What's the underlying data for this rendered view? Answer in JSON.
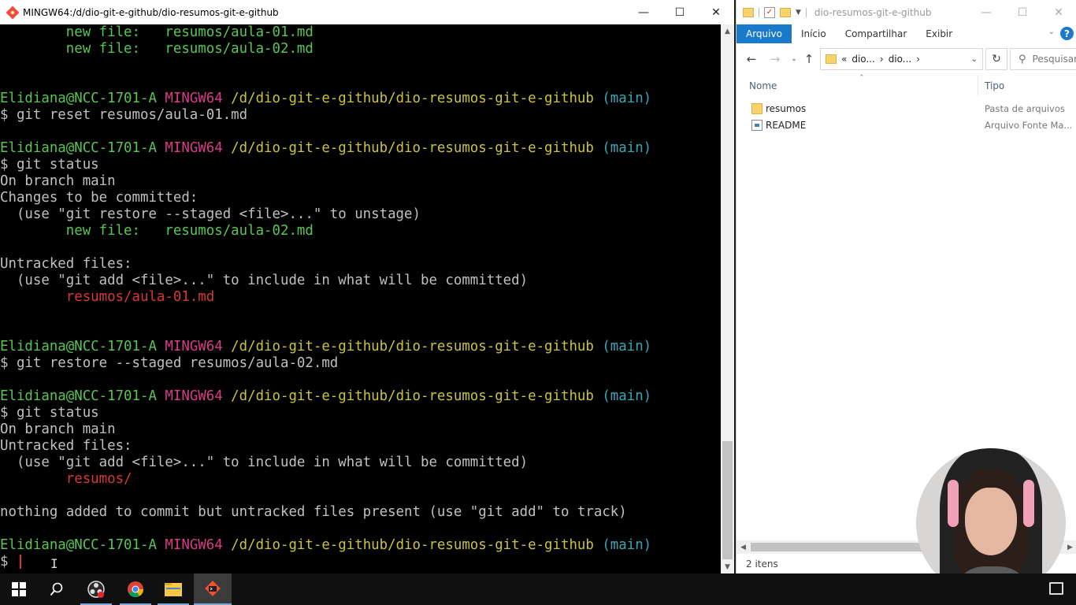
{
  "terminal": {
    "title": "MINGW64:/d/dio-git-e-github/dio-resumos-git-e-github",
    "lines": [
      [
        {
          "t": "        new file:   resumos/aula-01.md",
          "c": "green"
        }
      ],
      [
        {
          "t": "        new file:   resumos/aula-02.md",
          "c": "green"
        }
      ],
      [],
      [],
      [
        {
          "t": "Elidiana@NCC-1701-A ",
          "c": "green"
        },
        {
          "t": "MINGW64 ",
          "c": "magenta"
        },
        {
          "t": "/d/dio-git-e-github/dio-resumos-git-e-github ",
          "c": "yellow"
        },
        {
          "t": "(main)",
          "c": "cyan"
        }
      ],
      [
        {
          "t": "$ git reset resumos/aula-01.md",
          "c": ""
        }
      ],
      [],
      [
        {
          "t": "Elidiana@NCC-1701-A ",
          "c": "green"
        },
        {
          "t": "MINGW64 ",
          "c": "magenta"
        },
        {
          "t": "/d/dio-git-e-github/dio-resumos-git-e-github ",
          "c": "yellow"
        },
        {
          "t": "(main)",
          "c": "cyan"
        }
      ],
      [
        {
          "t": "$ git status",
          "c": ""
        }
      ],
      [
        {
          "t": "On branch main",
          "c": ""
        }
      ],
      [
        {
          "t": "Changes to be committed:",
          "c": ""
        }
      ],
      [
        {
          "t": "  (use \"git restore --staged <file>...\" to unstage)",
          "c": ""
        }
      ],
      [
        {
          "t": "        new file:   resumos/aula-02.md",
          "c": "green"
        }
      ],
      [],
      [
        {
          "t": "Untracked files:",
          "c": ""
        }
      ],
      [
        {
          "t": "  (use \"git add <file>...\" to include in what will be committed)",
          "c": ""
        }
      ],
      [
        {
          "t": "        resumos/aula-01.md",
          "c": "red"
        }
      ],
      [],
      [],
      [
        {
          "t": "Elidiana@NCC-1701-A ",
          "c": "green"
        },
        {
          "t": "MINGW64 ",
          "c": "magenta"
        },
        {
          "t": "/d/dio-git-e-github/dio-resumos-git-e-github ",
          "c": "yellow"
        },
        {
          "t": "(main)",
          "c": "cyan"
        }
      ],
      [
        {
          "t": "$ git restore --staged resumos/aula-02.md",
          "c": ""
        }
      ],
      [],
      [
        {
          "t": "Elidiana@NCC-1701-A ",
          "c": "green"
        },
        {
          "t": "MINGW64 ",
          "c": "magenta"
        },
        {
          "t": "/d/dio-git-e-github/dio-resumos-git-e-github ",
          "c": "yellow"
        },
        {
          "t": "(main)",
          "c": "cyan"
        }
      ],
      [
        {
          "t": "$ git status",
          "c": ""
        }
      ],
      [
        {
          "t": "On branch main",
          "c": ""
        }
      ],
      [
        {
          "t": "Untracked files:",
          "c": ""
        }
      ],
      [
        {
          "t": "  (use \"git add <file>...\" to include in what will be committed)",
          "c": ""
        }
      ],
      [
        {
          "t": "        resumos/",
          "c": "red"
        }
      ],
      [],
      [
        {
          "t": "nothing added to commit but untracked files present (use \"git add\" to track)",
          "c": ""
        }
      ],
      [],
      [
        {
          "t": "Elidiana@NCC-1701-A ",
          "c": "green"
        },
        {
          "t": "MINGW64 ",
          "c": "magenta"
        },
        {
          "t": "/d/dio-git-e-github/dio-resumos-git-e-github ",
          "c": "yellow"
        },
        {
          "t": "(main)",
          "c": "cyan"
        }
      ],
      [
        {
          "t": "$ ",
          "c": "",
          "cursor": true
        }
      ]
    ]
  },
  "explorer": {
    "title": "dio-resumos-git-e-github",
    "ribbon_tabs": [
      "Arquivo",
      "Início",
      "Compartilhar",
      "Exibir"
    ],
    "help": "?",
    "address_prefix": "«",
    "breadcrumbs": [
      "dio...",
      "dio..."
    ],
    "search_placeholder": "Pesquisar",
    "columns": {
      "name": "Nome",
      "type": "Tipo"
    },
    "items": [
      {
        "name": "resumos",
        "type": "Pasta de arquivos",
        "icon": "folder-icon"
      },
      {
        "name": "README",
        "type": "Arquivo Fonte Ma...",
        "icon": "markdown-file-icon"
      }
    ],
    "status": "2 itens"
  },
  "taskbar": {
    "apps": [
      "start-icon",
      "search-icon",
      "obs-icon",
      "chrome-icon",
      "file-explorer-icon",
      "git-bash-icon"
    ]
  },
  "colors": {
    "terminal_bg": "#000000",
    "accent": "#1979ca",
    "green": "#58c554",
    "magenta": "#d93b8a",
    "yellow": "#c9c340",
    "cyan": "#36a7b6",
    "red": "#d63737"
  }
}
